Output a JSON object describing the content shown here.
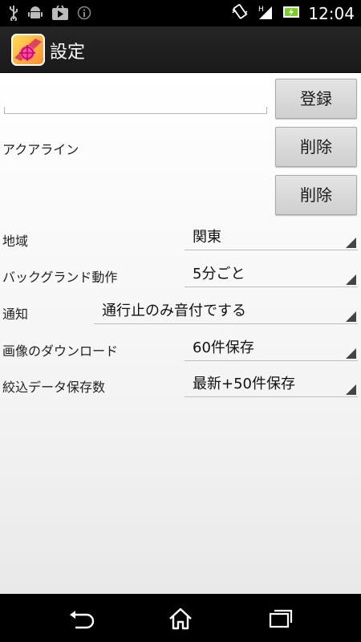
{
  "status_bar": {
    "time": "12:04"
  },
  "action_bar": {
    "title": "設定"
  },
  "form": {
    "register_button": "登録",
    "line1_name": "アクアライン",
    "delete_button_1": "削除",
    "delete_button_2": "削除",
    "settings": [
      {
        "label": "地域",
        "value": "関東"
      },
      {
        "label": "バックグランド動作",
        "value": "5分ごと"
      },
      {
        "label": "通知",
        "value": "通行止のみ音付でする"
      },
      {
        "label": "画像のダウンロード",
        "value": "60件保存"
      },
      {
        "label": "絞込データ保存数",
        "value": "最新+50件保存"
      }
    ]
  },
  "icons": [
    "usb-icon",
    "android-icon",
    "play-store-icon",
    "info-icon",
    "vibrate-icon",
    "signal-icon",
    "battery-icon",
    "back-icon",
    "home-icon",
    "recent-apps-icon"
  ],
  "colors": {
    "background": "#f4f4f4",
    "bars": "#000000"
  }
}
